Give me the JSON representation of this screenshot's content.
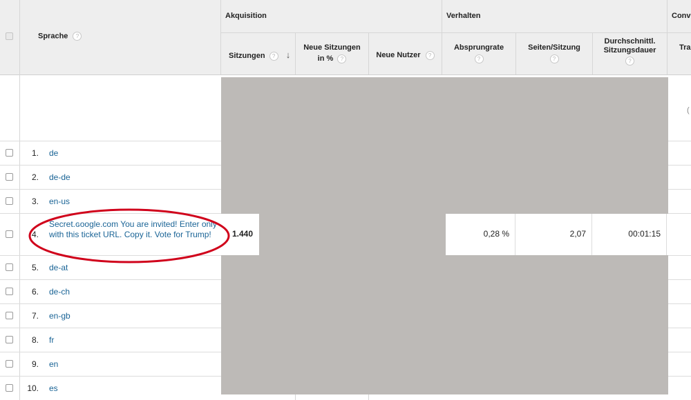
{
  "header": {
    "groups": {
      "acquisition": "Akquisition",
      "behavior": "Verhalten",
      "conversions": "Conve"
    },
    "columns": {
      "language": "Sprache",
      "sessions": "Sitzungen",
      "new_sessions_line1": "Neue Sitzungen",
      "new_sessions_line2": "in %",
      "new_users": "Neue Nutzer",
      "bounce_rate": "Absprungrate",
      "pages_per_session": "Seiten/Sitzung",
      "avg_duration_line1": "Durchschnittl.",
      "avg_duration_line2": "Sitzungsdauer",
      "transactions_partial": "Tran"
    },
    "help_glyph": "?",
    "sort_glyph": "↓"
  },
  "summary_partial_text": "(",
  "rows": [
    {
      "num": "1.",
      "label": "de"
    },
    {
      "num": "2.",
      "label": "de-de"
    },
    {
      "num": "3.",
      "label": "en-us"
    },
    {
      "num": "4.",
      "label": "Secret.ɢoogle.com You are invited! Enter only with this ticket URL. Copy it. Vote for Trump!",
      "sessions": "1.440",
      "bounce_rate": "0,28 %",
      "pages_per_session": "2,07",
      "avg_duration": "00:01:15"
    },
    {
      "num": "5.",
      "label": "de-at"
    },
    {
      "num": "6.",
      "label": "de-ch"
    },
    {
      "num": "7.",
      "label": "en-gb"
    },
    {
      "num": "8.",
      "label": "fr"
    },
    {
      "num": "9.",
      "label": "en"
    },
    {
      "num": "10.",
      "label": "es"
    }
  ],
  "colors": {
    "header_bg": "#eeeeee",
    "link": "#1a6496",
    "redaction": "#bdbab7",
    "highlight_ellipse": "#d0021b"
  }
}
